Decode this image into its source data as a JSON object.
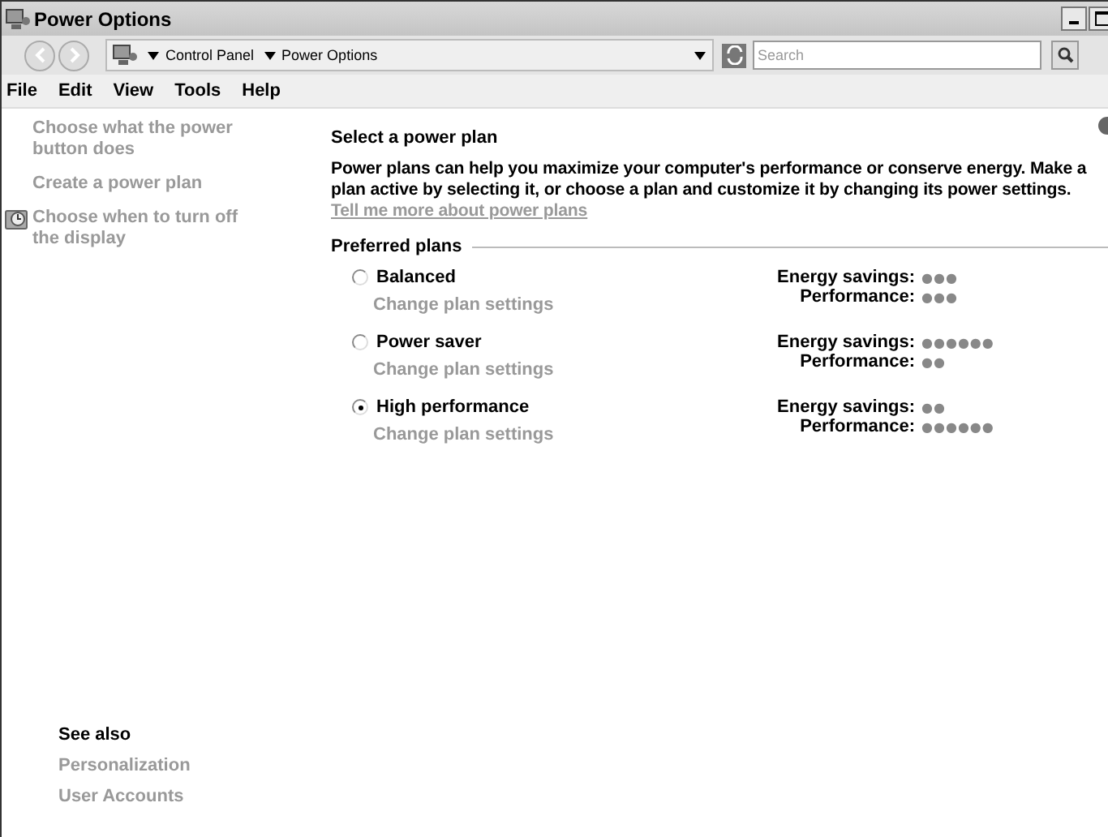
{
  "window": {
    "title": "Power Options"
  },
  "address_bar": {
    "breadcrumbs": [
      "Control Panel",
      "Power Options"
    ],
    "search": {
      "placeholder": "Search"
    }
  },
  "menu": [
    "File",
    "Edit",
    "View",
    "Tools",
    "Help"
  ],
  "sidebar": {
    "tasks": [
      {
        "label": "Choose what the power button does",
        "kind": "link"
      },
      {
        "label": "Create a power plan",
        "kind": "link"
      },
      {
        "label": "Choose when to turn off the display",
        "kind": "icon-link"
      }
    ],
    "see_also": {
      "title": "See also",
      "links": [
        "Personalization",
        "User Accounts"
      ]
    }
  },
  "main": {
    "title": "Select a power plan",
    "description": "Power plans can help you maximize your computer's performance or conserve energy. Make a plan active by selecting it, or choose a plan and customize it by changing its power settings.",
    "more_link": "Tell me more about power plans",
    "group_title": "Preferred plans",
    "plans": [
      {
        "name": "Balanced",
        "selected": false,
        "settings_link": "Change plan settings",
        "ratings": [
          {
            "label": "Energy savings:",
            "dots": "●●●"
          },
          {
            "label": "Performance:",
            "dots": "●●●"
          }
        ]
      },
      {
        "name": "Power saver",
        "selected": false,
        "settings_link": "Change plan settings",
        "ratings": [
          {
            "label": "Energy savings:",
            "dots": "●●●●●●"
          },
          {
            "label": "Performance:",
            "dots": "●●"
          }
        ]
      },
      {
        "name": "High performance",
        "selected": true,
        "settings_link": "Change plan settings",
        "ratings": [
          {
            "label": "Energy savings:",
            "dots": "●●"
          },
          {
            "label": "Performance:",
            "dots": "●●●●●●"
          }
        ]
      }
    ]
  }
}
